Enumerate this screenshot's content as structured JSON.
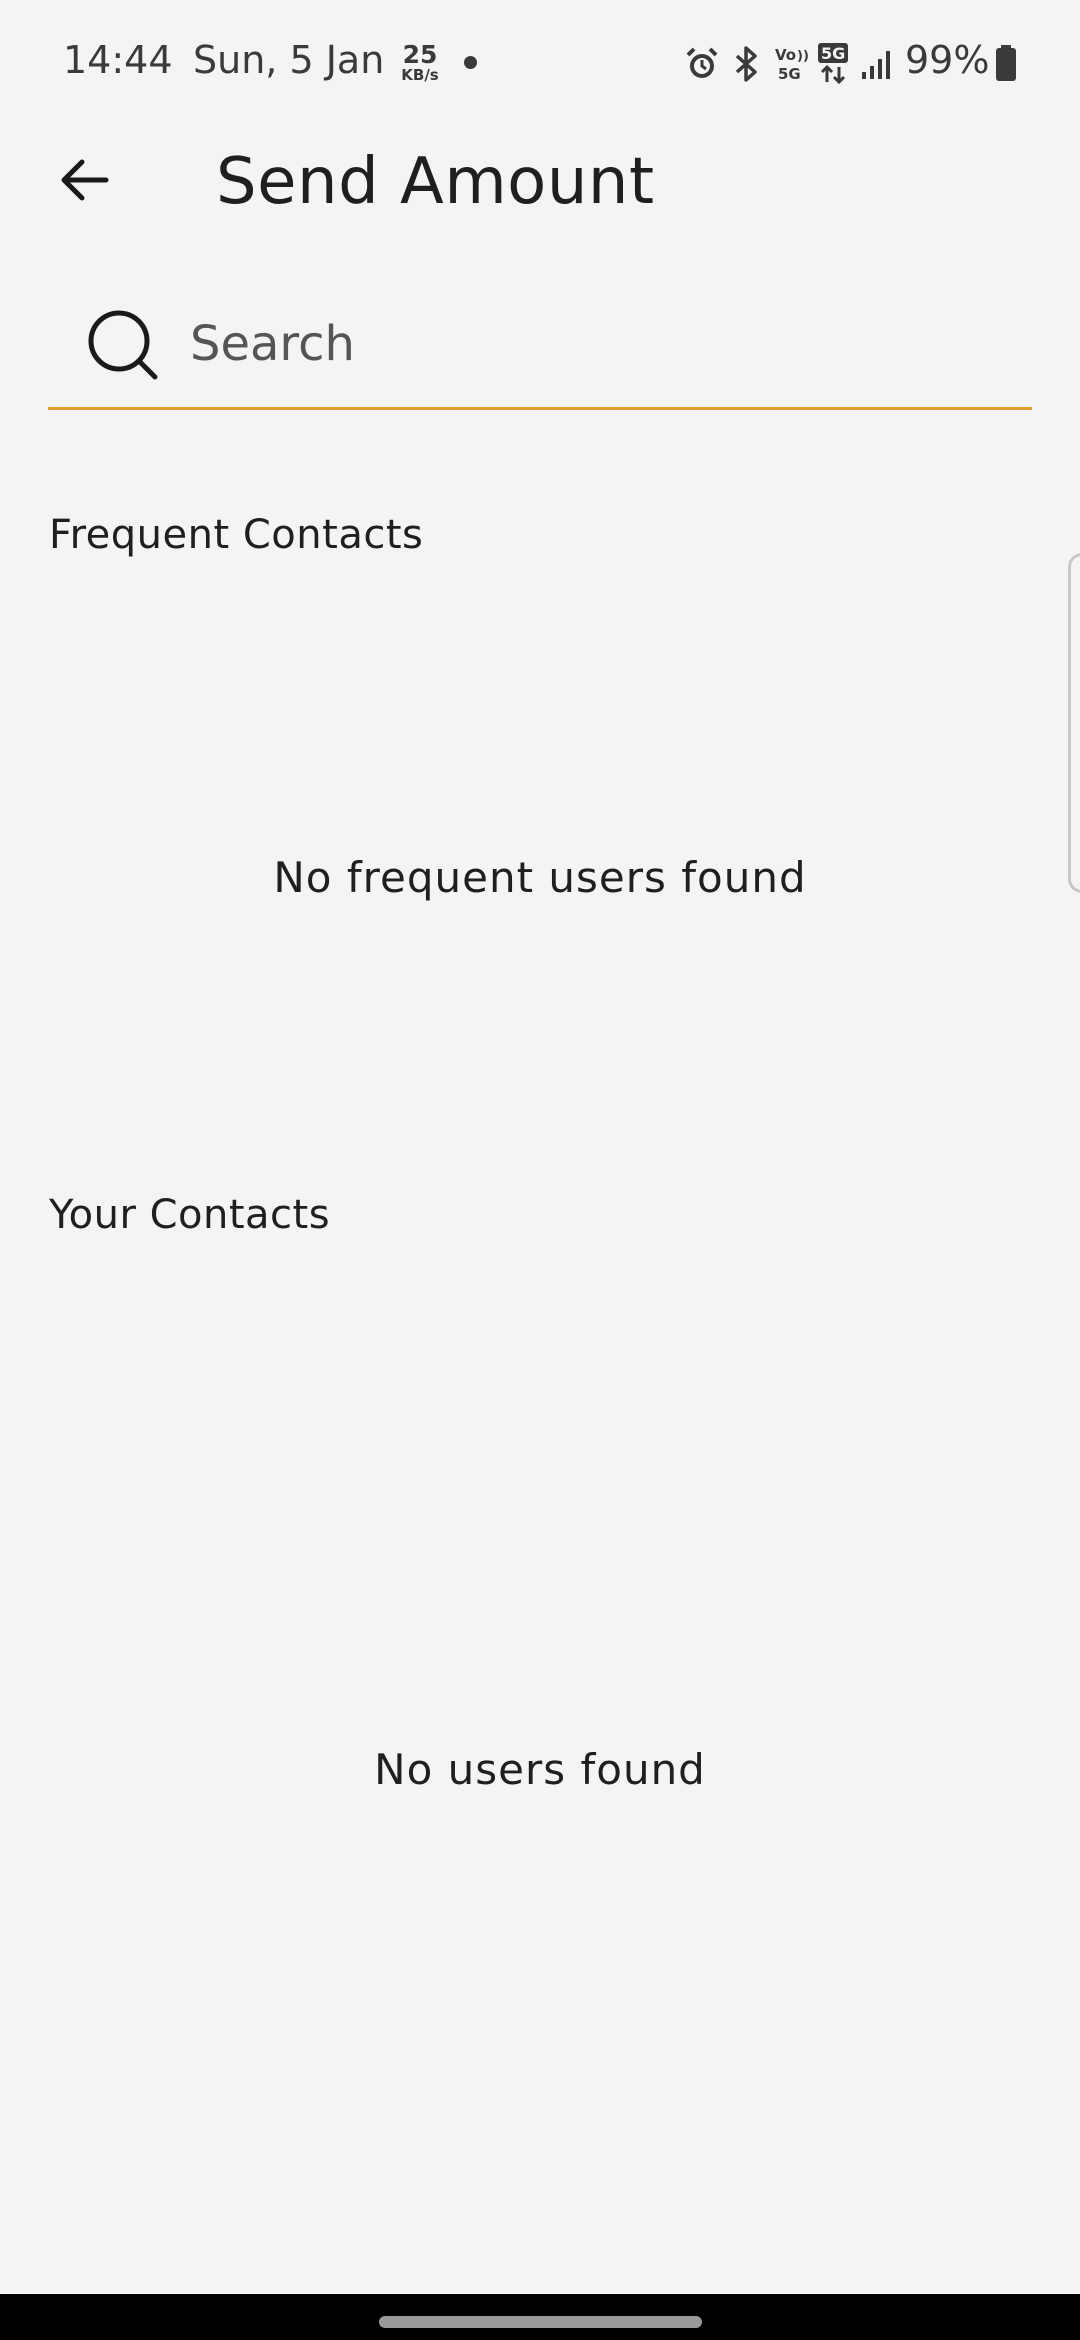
{
  "status_bar": {
    "time": "14:44",
    "date": "Sun, 5 Jan",
    "speed_value": "25",
    "speed_unit": "KB/s",
    "battery": "99%",
    "icons": [
      "alarm-icon",
      "bluetooth-icon",
      "volte-icon",
      "5g-icon",
      "signal-icon",
      "battery-icon"
    ]
  },
  "header": {
    "title": "Send Amount",
    "back_icon": "arrow-left-icon"
  },
  "search": {
    "placeholder": "Search",
    "value": "",
    "icon": "search-icon",
    "underline_color": "#e0a030"
  },
  "frequent": {
    "heading": "Frequent Contacts",
    "empty_message": "No frequent users found"
  },
  "contacts": {
    "heading": "Your Contacts",
    "empty_message": "No users found"
  },
  "colors": {
    "background": "#f4f4f4",
    "accent": "#e0a030",
    "text": "#1f1f1f"
  }
}
